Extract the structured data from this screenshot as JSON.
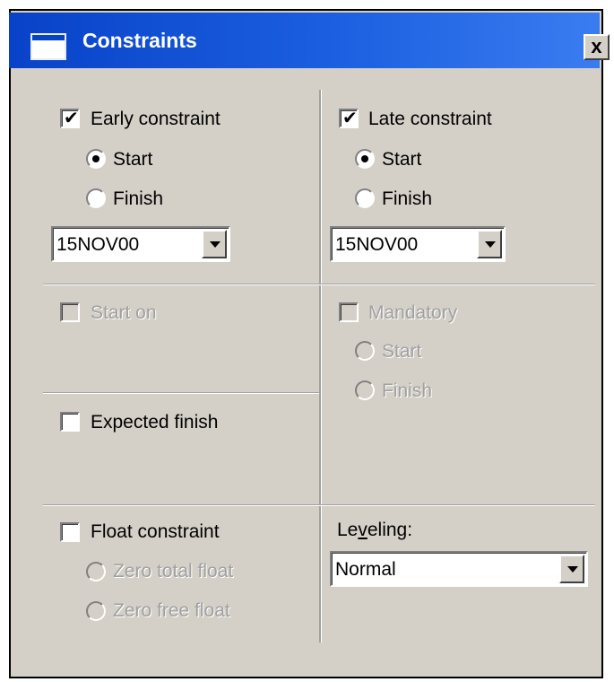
{
  "window": {
    "title": "Constraints",
    "close_glyph": "✖",
    "close_label": "x"
  },
  "early": {
    "label": "Early constraint",
    "checked": true,
    "start_label": "Start",
    "finish_label": "Finish",
    "date_value": "15NOV00"
  },
  "late": {
    "label": "Late constraint",
    "checked": true,
    "start_label": "Start",
    "finish_label": "Finish",
    "date_value": "15NOV00"
  },
  "start_on": {
    "label": "Start on"
  },
  "mandatory": {
    "label": "Mandatory",
    "start_label": "Start",
    "finish_label": "Finish"
  },
  "expected_finish": {
    "label": "Expected finish"
  },
  "float": {
    "label": "Float constraint",
    "zero_total_label": "Zero total float",
    "zero_free_label": "Zero free float"
  },
  "leveling": {
    "label_pre": "Le",
    "label_accel": "v",
    "label_post": "eling:",
    "value": "Normal"
  },
  "icons": {
    "window_icon": "window-icon",
    "check": "✔"
  }
}
